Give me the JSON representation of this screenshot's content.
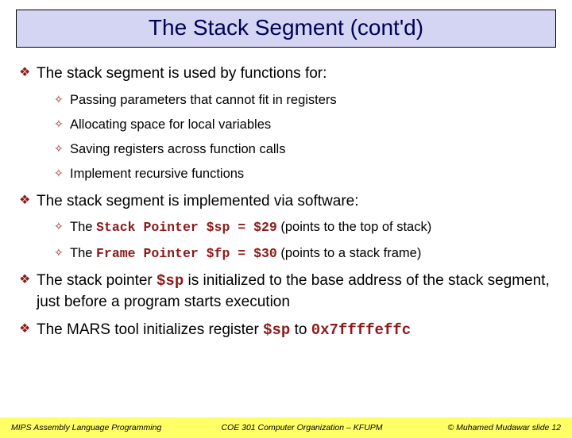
{
  "title": "The Stack Segment (cont'd)",
  "bullets1": {
    "b0": "The stack segment is used by functions for:",
    "sub": {
      "s0": "Passing parameters that cannot fit in registers",
      "s1": "Allocating space for local variables",
      "s2": "Saving registers across function calls",
      "s3": "Implement recursive functions"
    }
  },
  "bullets2": {
    "b0": "The stack segment is implemented via software:",
    "sub": {
      "s0a": "The ",
      "s0b": "Stack Pointer $sp = $29",
      "s0c": " (points to the top of stack)",
      "s1a": "The ",
      "s1b": "Frame Pointer $fp = $30",
      "s1c": " (points to a stack frame)"
    }
  },
  "bullets3": {
    "a": "The stack pointer ",
    "b": "$sp",
    "c": " is initialized to the base address of the stack segment, just before a program starts execution"
  },
  "bullets4": {
    "a": "The MARS tool initializes register ",
    "b": "$sp",
    "c": " to ",
    "d": "0x7ffffeffc"
  },
  "footer": {
    "left": "MIPS Assembly Language Programming",
    "center": "COE 301 Computer Organization – KFUPM",
    "right": "© Muhamed Mudawar   slide 12"
  }
}
